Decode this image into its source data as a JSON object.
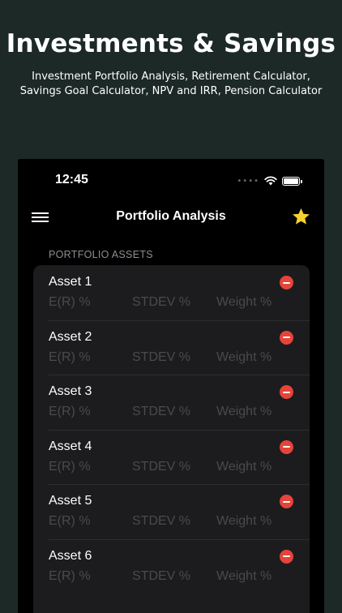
{
  "promo": {
    "title": "Investments & Savings",
    "subtitle_line1": "Investment Portfolio Analysis, Retirement Calculator,",
    "subtitle_line2": "Savings Goal Calculator, NPV and IRR, Pension Calculator"
  },
  "status_bar": {
    "time": "12:45",
    "icons": [
      "wifi-icon",
      "battery-icon"
    ]
  },
  "nav": {
    "title": "Portfolio Analysis",
    "left_icon": "hamburger-menu-icon",
    "right_icon": "star-icon",
    "accent": "#f5d232"
  },
  "section": {
    "header": "PORTFOLIO ASSETS"
  },
  "assets": [
    {
      "name": "Asset 1",
      "er_placeholder": "E(R) %",
      "stdev_placeholder": "STDEV %",
      "weight_placeholder": "Weight %"
    },
    {
      "name": "Asset 2",
      "er_placeholder": "E(R) %",
      "stdev_placeholder": "STDEV %",
      "weight_placeholder": "Weight %"
    },
    {
      "name": "Asset 3",
      "er_placeholder": "E(R) %",
      "stdev_placeholder": "STDEV %",
      "weight_placeholder": "Weight %"
    },
    {
      "name": "Asset 4",
      "er_placeholder": "E(R) %",
      "stdev_placeholder": "STDEV %",
      "weight_placeholder": "Weight %"
    },
    {
      "name": "Asset 5",
      "er_placeholder": "E(R) %",
      "stdev_placeholder": "STDEV %",
      "weight_placeholder": "Weight %"
    },
    {
      "name": "Asset 6",
      "er_placeholder": "E(R) %",
      "stdev_placeholder": "STDEV %",
      "weight_placeholder": "Weight %"
    }
  ],
  "colors": {
    "background": "#1c2926",
    "remove": "#e5443a",
    "card": "#1c1c1e"
  }
}
